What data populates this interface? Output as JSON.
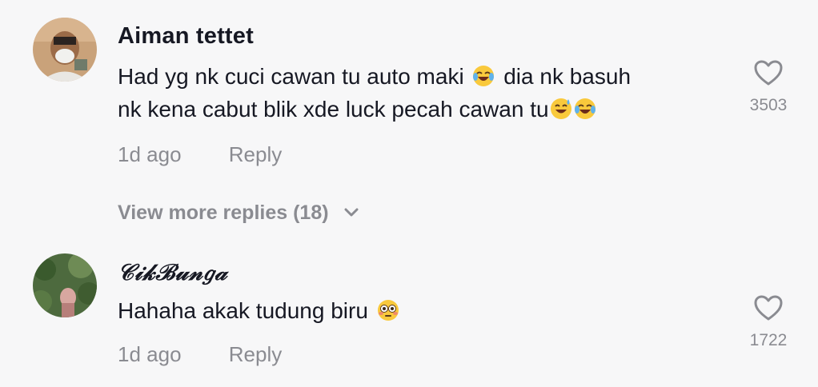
{
  "comments": [
    {
      "username": "Aiman tettet",
      "text_line1_a": "Had yg nk cuci cawan tu auto maki",
      "text_line1_b": "dia nk basuh",
      "text_line2": "nk kena cabut blik xde luck pecah cawan tu",
      "time": "1d ago",
      "reply_label": "Reply",
      "likes": "3503"
    },
    {
      "username": "𝒞𝒾𝓀ℬ𝓊𝓃𝑔𝒶",
      "text": "Hahaha akak tudung biru",
      "time": "1d ago",
      "reply_label": "Reply",
      "likes": "1722"
    }
  ],
  "view_more": {
    "label": "View more replies (18)"
  },
  "icons": {
    "like": "heart-outline-icon",
    "laugh": "face-with-tears-of-joy-emoji",
    "sweat": "grinning-face-with-sweat-emoji",
    "flushed": "flushed-face-emoji",
    "expand": "chevron-down-icon"
  },
  "colors": {
    "background": "#f7f7f8",
    "text": "#161823",
    "muted": "#8a8b91"
  }
}
